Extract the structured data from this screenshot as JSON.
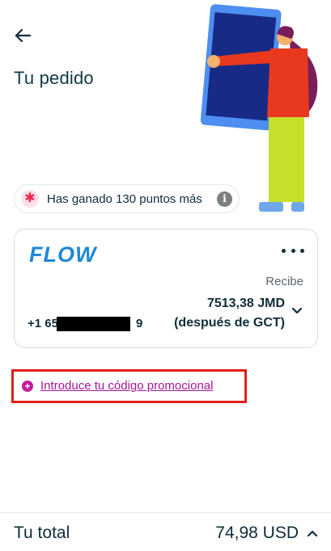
{
  "header": {
    "title": "Tu pedido"
  },
  "points": {
    "text": "Has ganado 130 puntos más"
  },
  "card": {
    "provider": "FLOW",
    "receive_label": "Recibe",
    "amount": "7513,38 JMD",
    "amount_note": "(después de GCT)",
    "phone_prefix": "+1 65",
    "phone_suffix": "9"
  },
  "promo": {
    "label": "Introduce tu código promocional"
  },
  "footer": {
    "total_label": "Tu total",
    "total_value": "74,98 USD"
  },
  "colors": {
    "accent_magenta": "#a51797",
    "flow_blue": "#1e88d6",
    "highlight_red": "#e0201b"
  }
}
